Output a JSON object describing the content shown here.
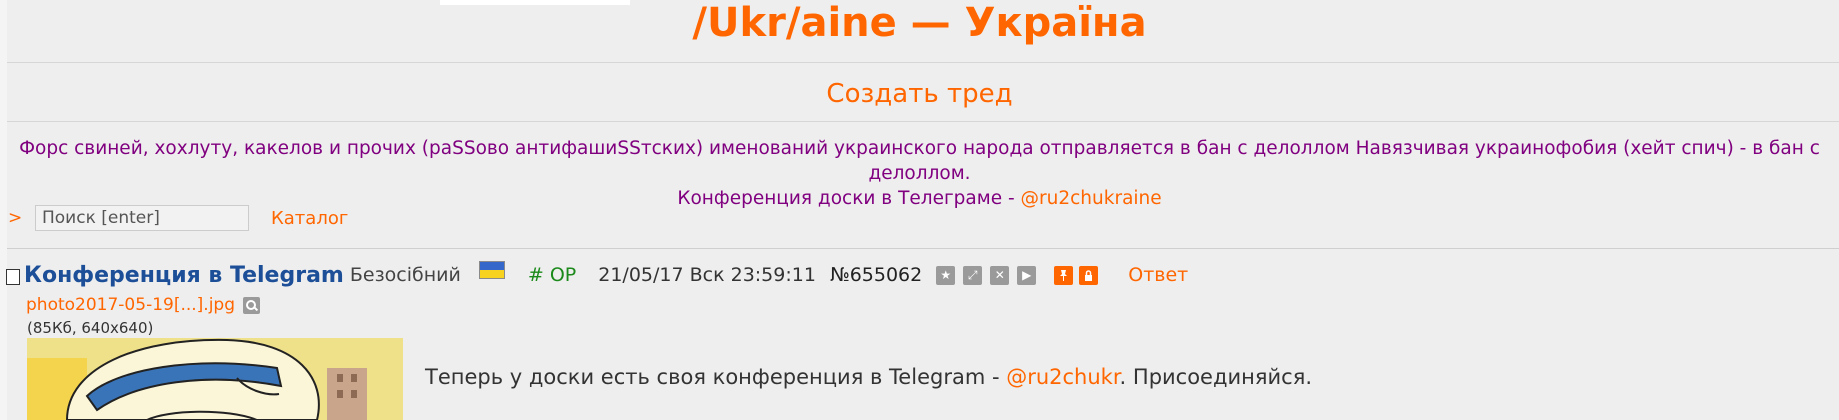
{
  "board": {
    "title": "/Ukr/aine — Україна",
    "create_thread": "Создать тред",
    "rules_line1": "Форс свиней, хохлуту, какелов и прочих (раSSово антифашиSSтских) именований украинского народа отправляется в бан с делоллом Навязчивая украинофобия (хейт спич) - в бан с делоллом.",
    "rules_line2_text": "Конференция доски в Телеграме - ",
    "rules_line2_link": "@ru2chukraine"
  },
  "search": {
    "arrow": ">",
    "placeholder": "Поиск [enter]",
    "catalog_label": "Каталог"
  },
  "post": {
    "subject": "Конференция в Telegram",
    "name": "Безосібний",
    "op_label": "# OP",
    "date": "21/05/17 Вск 23:59:11",
    "number": "№655062",
    "reply_label": "Ответ",
    "file": {
      "name": "photo2017-05-19[...].jpg",
      "info": "(85Кб, 640x640)"
    },
    "message_before": "Теперь у доски есть своя конференция в Telegram - ",
    "message_link": "@ru2chukr",
    "message_after": ". Присоединяйся.",
    "icons": [
      "star-icon",
      "expand-icon",
      "hide-icon",
      "play-icon",
      "pin-icon",
      "lock-icon"
    ]
  },
  "colors": {
    "accent": "#ff6600",
    "rules": "#800080",
    "subject": "#1c4f98",
    "op": "#1b8a1b",
    "background": "#eeeeee"
  }
}
